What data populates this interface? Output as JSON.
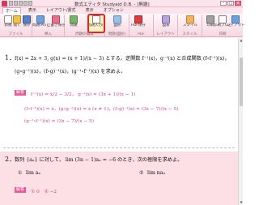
{
  "window": {
    "title": "数式エディタ Studyaid D.B. - [無題]",
    "min": "–",
    "max": "□",
    "close": "×"
  },
  "tabs": [
    "ホーム",
    "表示",
    "レイアウト/書式",
    "表示",
    "オプション"
  ],
  "ribbon": {
    "groups": [
      {
        "label": "ファイル",
        "buttons": [
          "新規",
          "開く",
          "保存"
        ]
      },
      {
        "label": "挿入",
        "buttons": [
          "問題/PinT",
          "上書き保存"
        ]
      },
      {
        "label": "問題の編集",
        "buttons": [
          "問題",
          "問題入力(通常)"
        ]
      },
      {
        "label": "問題(図形)",
        "buttons": [
          "図形"
        ]
      },
      {
        "label": "PDF",
        "buttons": [
          "PDF保存",
          "PDF"
        ]
      },
      {
        "label": "レイアウト",
        "buttons": [
          "図表",
          "レイアウト"
        ]
      },
      {
        "label": "スタイル",
        "buttons": [
          "スタイル",
          "スタイル"
        ]
      },
      {
        "label": "印刷",
        "buttons": [
          "印刷",
          "印刷プレビュー",
          "レイアウト調整"
        ]
      }
    ],
    "small_items": [
      "新しい問題を作成",
      "問題の編集(E)",
      "問題の移動",
      "問題の削除"
    ]
  },
  "problem1": {
    "number": "1．",
    "line1": "f(x) = 2x + 3,  g(x) = (x + 1)/(x − 3) とする。逆関数 f⁻¹(x)，g⁻¹(x) と合成関数 (f∘f⁻¹)(x)，",
    "line2": "(g∘g⁻¹)(x)，(f∘g)⁻¹(x)，(g⁻¹∘f⁻¹)(x) を求めよ。",
    "answer_label": "解答",
    "ans_line1": "f⁻¹(x) = x/2 − 3/2，  g⁻¹(x) = (3x + 1)/(x − 1)",
    "ans_line2": "(f∘f⁻¹)(x) = x，(g∘g⁻¹)(x) = x (x ≠ 1)，(f∘g)⁻¹(x) = (3x − 7)/(x − 5)",
    "ans_line3": "(g⁻¹∘f⁻¹)(x) = (3x − 7)/(x − 5)"
  },
  "problem2": {
    "number": "2．",
    "line1": "数列 {aₙ} に対して， lim (3n − 1)aₙ = −6 のとき，次の極限を求めよ。",
    "sub1_num": "①",
    "sub1": "lim aₙ",
    "sub2_num": "②",
    "sub2": "lim naₙ",
    "answer_label": "解答",
    "answer": "① 0　② −2"
  },
  "colors": {
    "accent": "#e85a9a",
    "answer_text": "#d43c8b",
    "ribbon_bg": "#fbe4ec",
    "highlight": "#e8231b"
  }
}
